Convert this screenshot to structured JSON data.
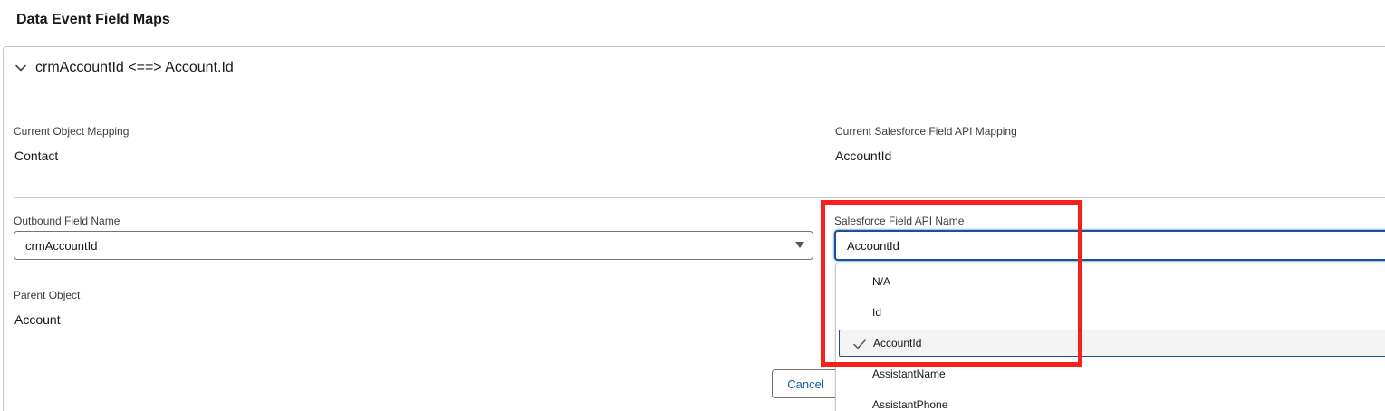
{
  "page": {
    "title": "Data Event Field Maps"
  },
  "accordion": {
    "header_label": "crmAccountId <==> Account.Id",
    "toggle_icon": "chevron-down-icon"
  },
  "current_mapping": {
    "object_label": "Current Object Mapping",
    "object_value": "Contact",
    "field_label": "Current Salesforce Field API Mapping",
    "field_value": "AccountId"
  },
  "form": {
    "outbound_label": "Outbound Field Name",
    "outbound_value": "crmAccountId",
    "sf_field_label": "Salesforce Field API Name",
    "sf_field_value": "AccountId",
    "parent_object_label": "Parent Object",
    "parent_object_value": "Account"
  },
  "dropdown": {
    "options": [
      {
        "label": "N/A",
        "selected": false
      },
      {
        "label": "Id",
        "selected": false
      },
      {
        "label": "AccountId",
        "selected": true
      },
      {
        "label": "AssistantName",
        "selected": false
      },
      {
        "label": "AssistantPhone",
        "selected": false
      }
    ],
    "check_icon": "check-icon"
  },
  "actions": {
    "cancel_label": "Cancel"
  },
  "colors": {
    "accent": "#1b5297",
    "link": "#0b5cab",
    "annotation": "#f5211c"
  }
}
